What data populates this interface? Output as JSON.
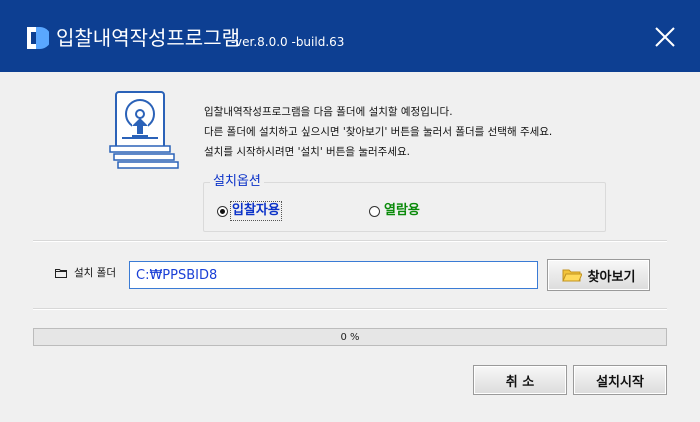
{
  "window": {
    "title": "입찰내역작성프로그램",
    "version": "-ver.8.0.0 -build.63",
    "close_icon": "close-icon",
    "accent_color": "#0d3f92"
  },
  "description": {
    "line1": "입찰내역작성프로그램을 다음 폴더에 설치할 예정입니다.",
    "line2": "다른 폴더에 설치하고 싶으시면 '찾아보기' 버튼을 눌러서 폴더를 선택해 주세요.",
    "line3": "설치를 시작하시려면 '설치' 버튼을 눌러주세요."
  },
  "options": {
    "legend": "설치옵션",
    "items": [
      {
        "label": "입찰자용",
        "selected": true,
        "color": "#0b32c8"
      },
      {
        "label": "열람용",
        "selected": false,
        "color": "#0a8a0a"
      }
    ]
  },
  "folder": {
    "label": "설치 폴더",
    "path": "C:₩PPSBID8",
    "browse_label": "찾아보기",
    "browse_icon": "folder-icon"
  },
  "progress": {
    "percent": 0,
    "text": "0 %"
  },
  "buttons": {
    "cancel": "취 소",
    "install": "설치시작"
  }
}
